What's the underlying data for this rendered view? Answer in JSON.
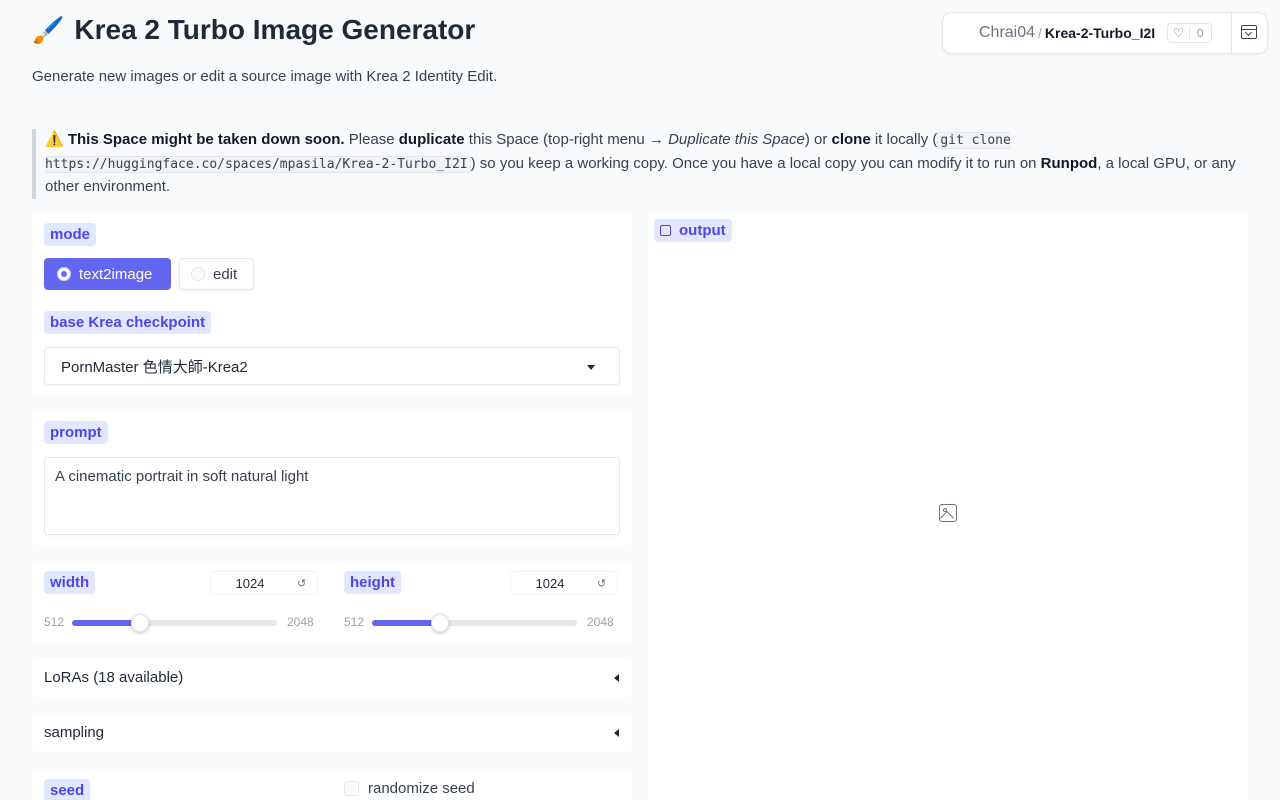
{
  "header": {
    "emoji": "🖌️",
    "title": "Krea 2 Turbo Image Generator",
    "subtitle": "Generate new images or edit a source image with Krea 2 Identity Edit."
  },
  "space_badge": {
    "owner": "Chrai04",
    "separator": "/",
    "repo": "Krea-2-Turbo_I2I",
    "likes": "0"
  },
  "notice": {
    "warning_emoji": "⚠️",
    "bold_lead": "This Space might be taken down soon.",
    "text_please": " Please ",
    "bold_duplicate": "duplicate",
    "text_menu": " this Space (top-right menu → ",
    "italic_menu": "Duplicate this Space",
    "text_or": ") or ",
    "bold_clone": "clone",
    "text_locally": " it locally (",
    "code_clone": "git clone https://huggingface.co/spaces/mpasila/Krea-2-Turbo_I2I",
    "text_after": ") so you keep a working copy. Once you have a local copy you can modify it to run on ",
    "bold_runpod": "Runpod",
    "text_end": ", a local GPU, or any other environment."
  },
  "mode": {
    "label": "mode",
    "options": [
      "text2image",
      "edit"
    ],
    "selected": "text2image"
  },
  "checkpoint": {
    "label": "base Krea checkpoint",
    "value": "PornMaster 色情大師-Krea2"
  },
  "prompt": {
    "label": "prompt",
    "value": "A cinematic portrait in soft natural light"
  },
  "width": {
    "label": "width",
    "value": "1024",
    "min": "512",
    "max": "2048",
    "fraction": 0.3333
  },
  "height": {
    "label": "height",
    "value": "1024",
    "min": "512",
    "max": "2048",
    "fraction": 0.3333
  },
  "loras": {
    "label": "LoRAs (18 available)"
  },
  "sampling": {
    "label": "sampling"
  },
  "seed": {
    "label": "seed",
    "randomize_label": "randomize seed"
  },
  "output": {
    "label": "output"
  }
}
